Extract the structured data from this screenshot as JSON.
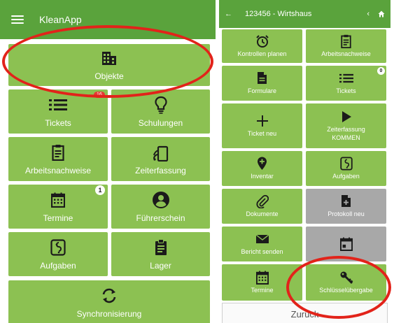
{
  "left": {
    "header": {
      "title": "KleanApp",
      "menu_icon": "hamburger-icon"
    },
    "tiles": {
      "objekte": {
        "label": "Objekte",
        "icon": "building-icon"
      },
      "tickets": {
        "label": "Tickets",
        "icon": "list-icon",
        "badge": "16"
      },
      "schulungen": {
        "label": "Schulungen",
        "icon": "lightbulb-icon"
      },
      "arbeitsnachweise": {
        "label": "Arbeitsnachweise",
        "icon": "clipboard-icon"
      },
      "zeiterfassung": {
        "label": "Zeiterfassung",
        "icon": "nfc-tap-icon"
      },
      "termine": {
        "label": "Termine",
        "icon": "calendar-icon",
        "badge": "1"
      },
      "fuehrerschein": {
        "label": "Führerschein",
        "icon": "person-circle-icon"
      },
      "aufgaben": {
        "label": "Aufgaben",
        "icon": "tasks-icon"
      },
      "lager": {
        "label": "Lager",
        "icon": "clipboard-list-icon"
      },
      "synchronisierung": {
        "label": "Synchronisierung",
        "icon": "sync-icon"
      }
    }
  },
  "right": {
    "header": {
      "title": "123456 - Wirtshaus",
      "back_icon": "arrow-left-icon",
      "prev_icon": "chevron-left-icon",
      "home_icon": "home-icon"
    },
    "tiles": {
      "kontrollen_planen": {
        "label": "Kontrollen planen",
        "icon": "alarm-icon"
      },
      "arbeitsnachweise": {
        "label": "Arbeitsnachweise",
        "icon": "clipboard-icon"
      },
      "formulare": {
        "label": "Formulare",
        "icon": "document-icon"
      },
      "tickets": {
        "label": "Tickets",
        "icon": "list-icon",
        "badge": "0"
      },
      "ticket_neu": {
        "label": "Ticket neu",
        "icon": "plus-icon"
      },
      "zeiterfassung_kommen": {
        "label": "Zeiterfassung KOMMEN",
        "icon": "play-icon"
      },
      "inventar": {
        "label": "Inventar",
        "icon": "map-pin-plus-icon"
      },
      "aufgaben": {
        "label": "Aufgaben",
        "icon": "tasks-icon"
      },
      "dokumente": {
        "label": "Dokumente",
        "icon": "paperclip-icon"
      },
      "protokoll_neu": {
        "label": "Protokoll neu",
        "icon": "document-plus-icon"
      },
      "bericht_senden": {
        "label": "Bericht senden",
        "icon": "envelope-icon"
      },
      "termine": {
        "label": "Termine",
        "icon": "calendar-icon"
      },
      "schluesseluebergabe": {
        "label": "Schlüsselübergabe",
        "icon": "key-icon"
      }
    },
    "back_button": "Zurück"
  },
  "colors": {
    "header": "#5aa33c",
    "tile": "#8cc152",
    "tile_disabled": "#a8a8a8",
    "annotation": "#e2231a"
  }
}
